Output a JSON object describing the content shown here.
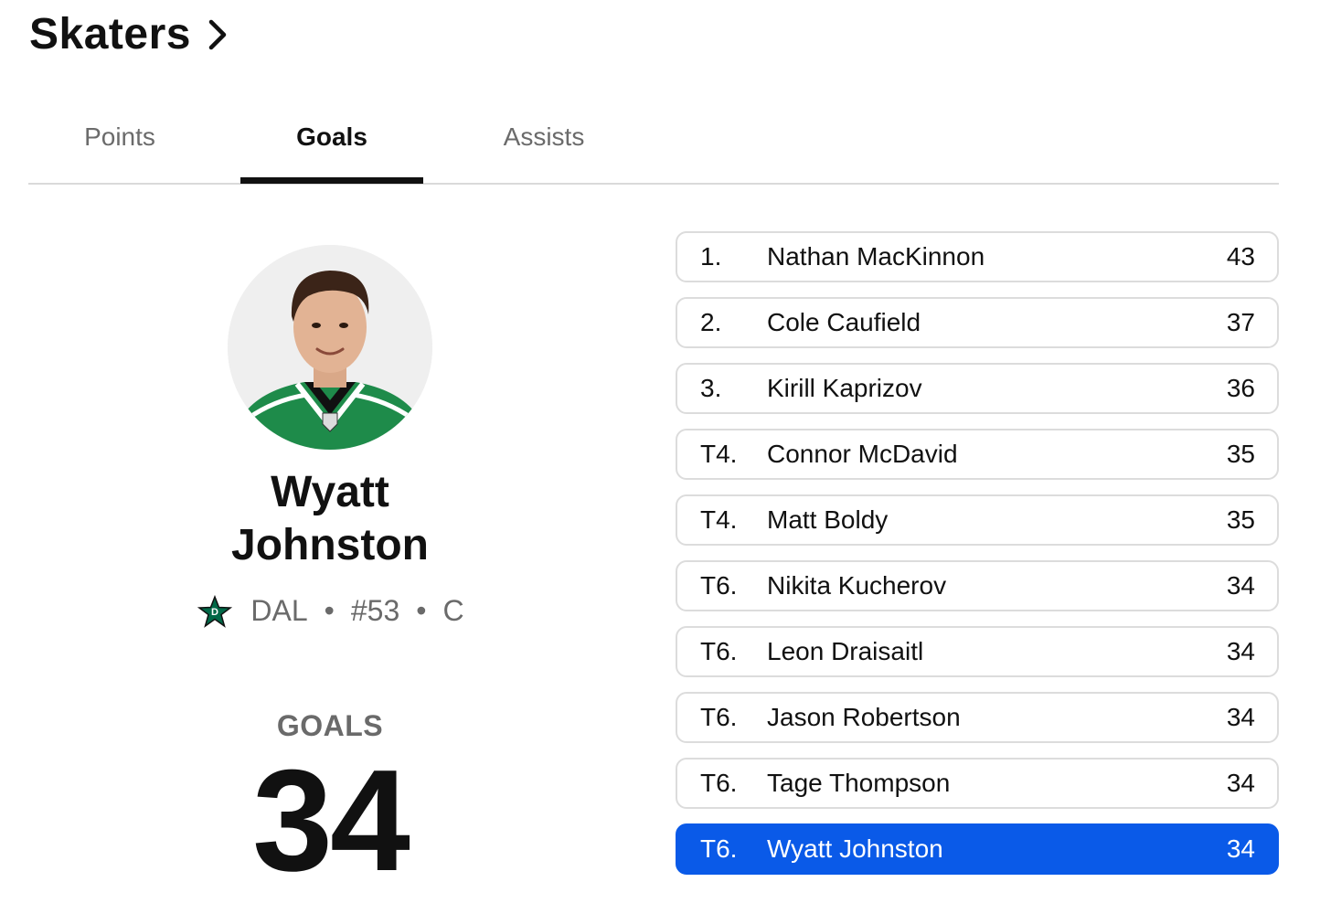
{
  "header": {
    "title": "Skaters"
  },
  "tabs": [
    {
      "label": "Points"
    },
    {
      "label": "Goals"
    },
    {
      "label": "Assists"
    }
  ],
  "featured": {
    "first_name": "Wyatt",
    "last_name": "Johnston",
    "team": "DAL",
    "separator": "•",
    "number": "#53",
    "position": "C",
    "stat_label": "GOALS",
    "stat_value": "34"
  },
  "leaders": [
    {
      "rank": "1.",
      "name": "Nathan MacKinnon",
      "value": "43"
    },
    {
      "rank": "2.",
      "name": "Cole Caufield",
      "value": "37"
    },
    {
      "rank": "3.",
      "name": "Kirill Kaprizov",
      "value": "36"
    },
    {
      "rank": "T4.",
      "name": "Connor McDavid",
      "value": "35"
    },
    {
      "rank": "T4.",
      "name": "Matt Boldy",
      "value": "35"
    },
    {
      "rank": "T6.",
      "name": "Nikita Kucherov",
      "value": "34"
    },
    {
      "rank": "T6.",
      "name": "Leon Draisaitl",
      "value": "34"
    },
    {
      "rank": "T6.",
      "name": "Jason Robertson",
      "value": "34"
    },
    {
      "rank": "T6.",
      "name": "Tage Thompson",
      "value": "34"
    },
    {
      "rank": "T6.",
      "name": "Wyatt Johnston",
      "value": "34"
    }
  ],
  "colors": {
    "accent": "#0a5ae8",
    "team_green": "#006847",
    "text_primary": "#111111",
    "text_secondary": "#6a6a6a"
  },
  "icons": {
    "header_chevron": "chevron-right-icon",
    "team_logo": "dallas-stars-logo-icon"
  }
}
